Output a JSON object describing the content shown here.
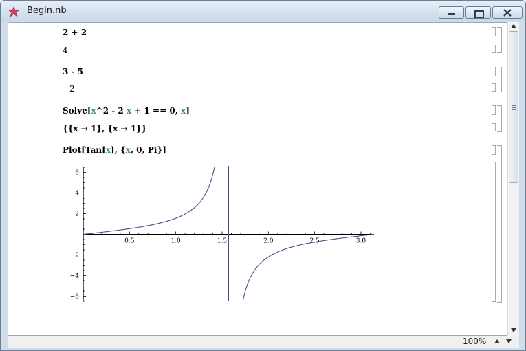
{
  "window": {
    "title": "Begin.nb"
  },
  "notebook": {
    "cells": [
      {
        "input": [
          {
            "t": "2 + 2",
            "v": false
          }
        ],
        "output": "4"
      },
      {
        "input": [
          {
            "t": "3 - 5",
            "v": false
          }
        ],
        "output": "2"
      },
      {
        "input": [
          {
            "t": "Solve[",
            "v": false
          },
          {
            "t": "x",
            "v": true
          },
          {
            "t": "^2 - 2 ",
            "v": false
          },
          {
            "t": "x",
            "v": true
          },
          {
            "t": " + 1 == 0, ",
            "v": false
          },
          {
            "t": "x",
            "v": true
          },
          {
            "t": "]",
            "v": false
          }
        ],
        "output": "{{x → 1}, {x → 1}}"
      },
      {
        "input": [
          {
            "t": "Plot[Tan[",
            "v": false
          },
          {
            "t": "x",
            "v": true
          },
          {
            "t": "], {",
            "v": false
          },
          {
            "t": "x",
            "v": true
          },
          {
            "t": ", 0, Pi}]",
            "v": false
          }
        ]
      }
    ]
  },
  "plot": {
    "x_ticks": [
      "0.5",
      "1.0",
      "1.5",
      "2.0",
      "2.5",
      "3.0"
    ],
    "y_ticks": [
      "6",
      "4",
      "2",
      "−2",
      "−4",
      "−6"
    ],
    "line_color": "#4c4c8c"
  },
  "chart_data": {
    "type": "line",
    "function": "Tan[x]",
    "xlim": [
      0,
      3.14159
    ],
    "ylim": [
      -6.5,
      6.5
    ],
    "x_ticks": [
      0.5,
      1.0,
      1.5,
      2.0,
      2.5,
      3.0
    ],
    "y_ticks": [
      6,
      4,
      2,
      -2,
      -4,
      -6
    ],
    "series": [
      {
        "x": [
          0,
          0.25,
          0.5,
          0.75,
          1.0,
          1.2,
          1.3,
          1.4,
          1.42
        ],
        "y": [
          0,
          0.26,
          0.55,
          0.93,
          1.56,
          2.57,
          3.6,
          5.8,
          6.5
        ]
      },
      {
        "x": [
          1.72,
          1.75,
          1.85,
          2.0,
          2.25,
          2.5,
          2.75,
          3.0,
          3.14
        ],
        "y": [
          -6.5,
          -5.5,
          -3.5,
          -2.19,
          -1.24,
          -0.75,
          -0.41,
          -0.14,
          0
        ]
      }
    ]
  },
  "status": {
    "zoom": "100%"
  }
}
